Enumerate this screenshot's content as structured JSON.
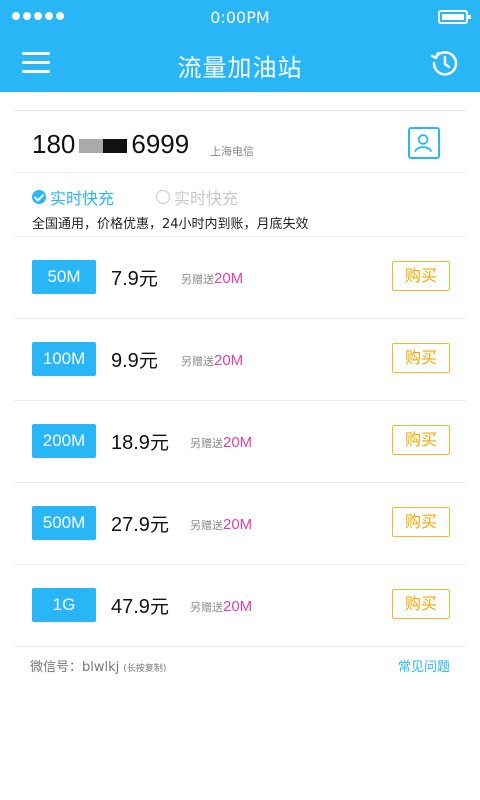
{
  "status": {
    "time": "0:00PM"
  },
  "header": {
    "title": "流量加油站"
  },
  "phone": {
    "prefix": "180",
    "suffix": "6999",
    "carrier": "上海电信"
  },
  "options": {
    "active_label": "实时快充",
    "inactive_label": "实时快充",
    "description": "全国通用，价格优惠，24小时内到账，月底失效"
  },
  "packages": [
    {
      "size": "50M",
      "price": "7.9",
      "unit": "元",
      "bonus_label": "另赠送",
      "bonus": "20M",
      "buy": "购买"
    },
    {
      "size": "100M",
      "price": "9.9",
      "unit": "元",
      "bonus_label": "另赠送",
      "bonus": "20M",
      "buy": "购买"
    },
    {
      "size": "200M",
      "price": "18.9",
      "unit": "元",
      "bonus_label": "另赠送",
      "bonus": "20M",
      "buy": "购买"
    },
    {
      "size": "500M",
      "price": "27.9",
      "unit": "元",
      "bonus_label": "另赠送",
      "bonus": "20M",
      "buy": "购买"
    },
    {
      "size": "1G",
      "price": "47.9",
      "unit": "元",
      "bonus_label": "另赠送",
      "bonus": "20M",
      "buy": "购买"
    }
  ],
  "footer": {
    "wechat_label": "微信号：",
    "wechat_id": "blwlkj",
    "wechat_hint": "(长按复制)",
    "faq": "常见问题"
  },
  "colors": {
    "accent": "#29b6f6",
    "buy": "#f5b731",
    "bonus": "#e040b0"
  }
}
